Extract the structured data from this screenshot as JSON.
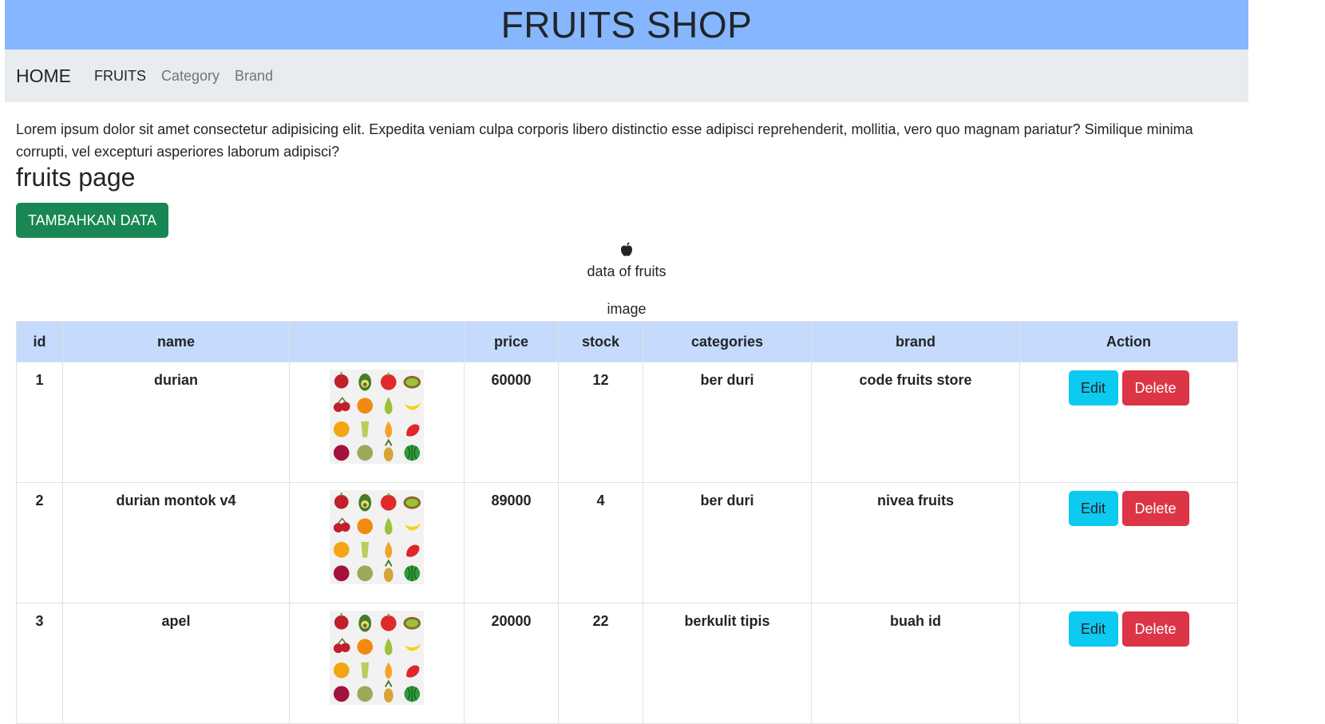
{
  "header": {
    "title": "FRUITS SHOP"
  },
  "nav": {
    "brand": "HOME",
    "links": [
      "FRUITS",
      "Category",
      "Brand"
    ]
  },
  "intro": "Lorem ipsum dolor sit amet consectetur adipisicing elit. Expedita veniam culpa corporis libero distinctio esse adipisci reprehenderit, mollitia, vero quo magnam pariatur? Similique minima corrupti, vel excepturi asperiores laborum adipisci?",
  "page": {
    "title": "fruits page",
    "add_button": "TAMBAHKAN DATA",
    "logo_icon": "apple-icon",
    "caption": "data of fruits",
    "image_caption": "image"
  },
  "table": {
    "headers": [
      "id",
      "name",
      "",
      "price",
      "stock",
      "categories",
      "brand",
      "Action"
    ],
    "rows": [
      {
        "id": "1",
        "name": "durian",
        "price": "60000",
        "stock": "12",
        "category": "ber duri",
        "brand": "code fruits store"
      },
      {
        "id": "2",
        "name": "durian montok v4",
        "price": "89000",
        "stock": "4",
        "category": "ber duri",
        "brand": "nivea fruits"
      },
      {
        "id": "3",
        "name": "apel",
        "price": "20000",
        "stock": "22",
        "category": "berkulit tipis",
        "brand": "buah id"
      }
    ],
    "edit_label": "Edit",
    "delete_label": "Delete"
  },
  "colors": {
    "header_bg": "#86b7fe",
    "nav_bg": "#e9ecef",
    "table_head_bg": "#c5dafc",
    "add_button": "#198754",
    "edit_button": "#0dcaf0",
    "delete_button": "#dc3545"
  }
}
